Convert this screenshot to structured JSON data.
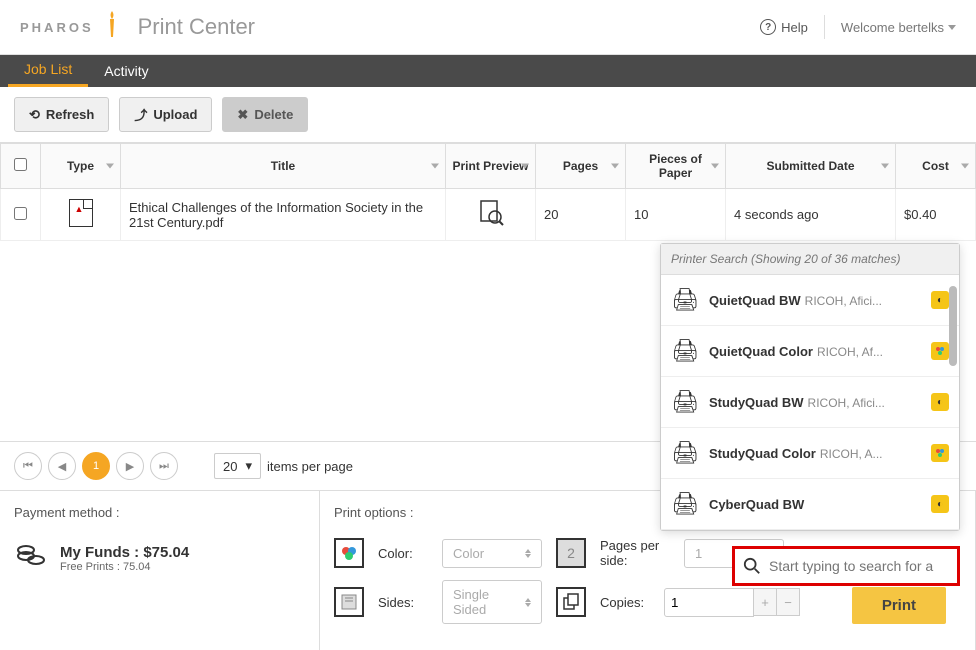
{
  "header": {
    "brand": "PHAROS",
    "app_title": "Print Center",
    "help_label": "Help",
    "welcome": "Welcome bertelks"
  },
  "nav": {
    "tabs": [
      "Job List",
      "Activity"
    ],
    "active": 0
  },
  "toolbar": {
    "refresh": "Refresh",
    "upload": "Upload",
    "delete": "Delete"
  },
  "columns": {
    "type": "Type",
    "title": "Title",
    "preview": "Print Preview",
    "pages": "Pages",
    "pieces": "Pieces of Paper",
    "submitted": "Submitted Date",
    "cost": "Cost"
  },
  "rows": [
    {
      "title": "Ethical Challenges of the Information Society in the 21st Century.pdf",
      "pages": "20",
      "pieces": "10",
      "submitted": "4 seconds ago",
      "cost": "$0.40"
    }
  ],
  "pagination": {
    "current": "1",
    "items_per_page": "20",
    "ipp_label": "items per page"
  },
  "payment": {
    "title": "Payment method :",
    "funds_label": "My Funds : $75.04",
    "free_prints": "Free Prints : 75.04"
  },
  "print_options": {
    "title": "Print options :",
    "color_label": "Color:",
    "color_value": "Color",
    "pps_label": "Pages per side:",
    "pps_value": "1",
    "sides_label": "Sides:",
    "sides_value": "Single Sided",
    "copies_label": "Copies:",
    "copies_value": "1"
  },
  "printer_search": {
    "header": "Printer Search (Showing 20 of 36 matches)",
    "printers": [
      {
        "name": "QuietQuad BW",
        "model": "RICOH, Afici...",
        "color": false
      },
      {
        "name": "QuietQuad Color",
        "model": "RICOH, Af...",
        "color": true
      },
      {
        "name": "StudyQuad BW",
        "model": "RICOH, Afici...",
        "color": false
      },
      {
        "name": "StudyQuad Color",
        "model": "RICOH, A...",
        "color": true
      },
      {
        "name": "CyberQuad BW",
        "model": "",
        "color": false
      }
    ],
    "search_placeholder": "Start typing to search for a"
  },
  "print_button": "Print"
}
